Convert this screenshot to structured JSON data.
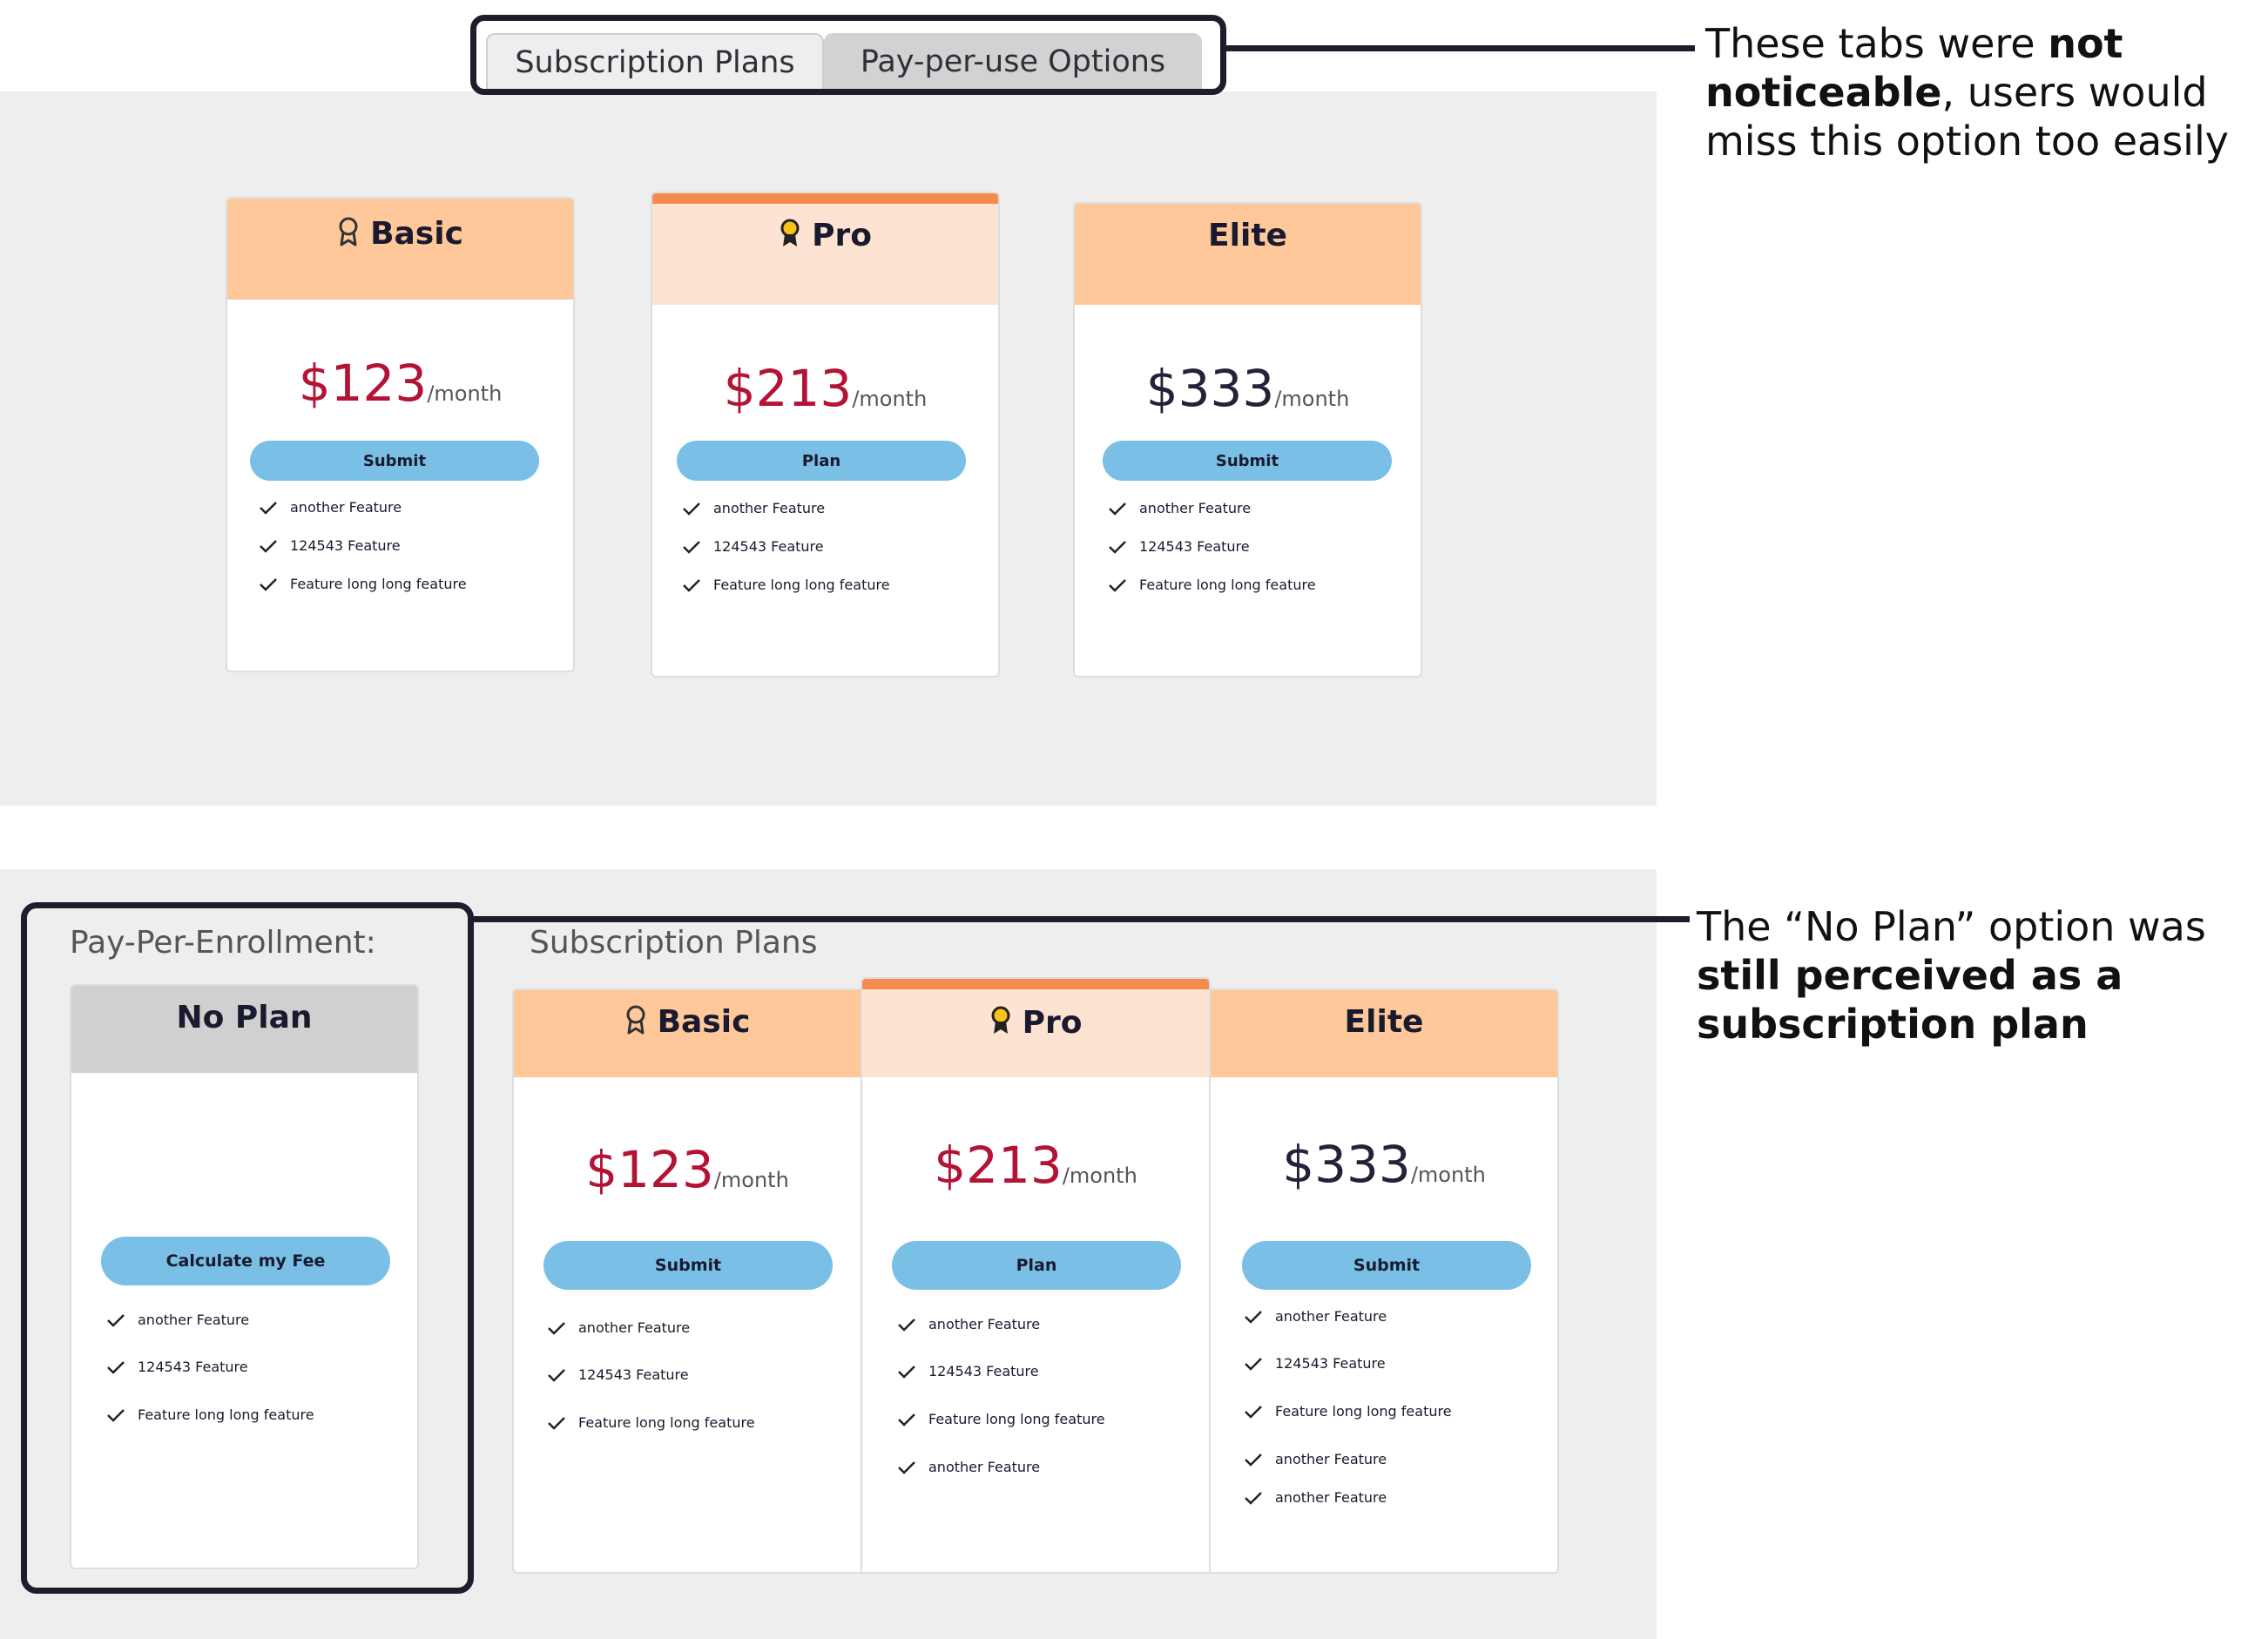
{
  "tabs": {
    "subscription": "Subscription Plans",
    "payperuse": "Pay-per-use Options"
  },
  "callouts": {
    "tabs_parts": [
      "These tabs were ",
      "not noticeable",
      ", users would miss this option too easily"
    ],
    "noplan_parts": [
      "The “No Plan” option was ",
      "still perceived as a subscription plan"
    ]
  },
  "top": {
    "plans": [
      {
        "name": "Basic",
        "price": "$123",
        "period": "/month",
        "button": "Submit",
        "features": [
          "another Feature",
          "124543 Feature",
          "Feature long long feature"
        ]
      },
      {
        "name": "Pro",
        "price": "$213",
        "period": "/month",
        "button": "Plan",
        "features": [
          "another Feature",
          "124543 Feature",
          "Feature long long feature"
        ]
      },
      {
        "name": "Elite",
        "price": "$333",
        "period": "/month",
        "button": "Submit",
        "features": [
          "another Feature",
          "124543 Feature",
          "Feature long long feature"
        ]
      }
    ]
  },
  "bottom": {
    "enrollment_label": "Pay-Per-Enrollment:",
    "subscription_label": "Subscription Plans",
    "noplan": {
      "name": "No Plan",
      "button": "Calculate my Fee",
      "features": [
        "another Feature",
        "124543 Feature",
        "Feature long long feature"
      ]
    },
    "plans": [
      {
        "name": "Basic",
        "price": "$123",
        "period": "/month",
        "button": "Submit",
        "features": [
          "another Feature",
          "124543 Feature",
          "Feature long long feature"
        ]
      },
      {
        "name": "Pro",
        "price": "$213",
        "period": "/month",
        "button": "Plan",
        "features": [
          "another Feature",
          "124543 Feature",
          "Feature long long feature",
          "another Feature"
        ]
      },
      {
        "name": "Elite",
        "price": "$333",
        "period": "/month",
        "button": "Submit",
        "features": [
          "another Feature",
          "124543 Feature",
          "Feature long long feature",
          "another Feature",
          "another Feature"
        ]
      }
    ]
  },
  "colors": {
    "panel": "#eeeeee",
    "header_orange": "#fec89a",
    "header_light": "#fde4d2",
    "pro_strip": "#f58c4e",
    "button": "#79bfe6",
    "price_red": "#b31334",
    "price_dark": "#22223a",
    "noplan_header": "#d0d0d0",
    "highlight_border": "#1d1d2b"
  },
  "icons": {
    "basic": "award-outline-icon",
    "pro": "award-gold-icon",
    "feature": "checkmark-icon"
  }
}
